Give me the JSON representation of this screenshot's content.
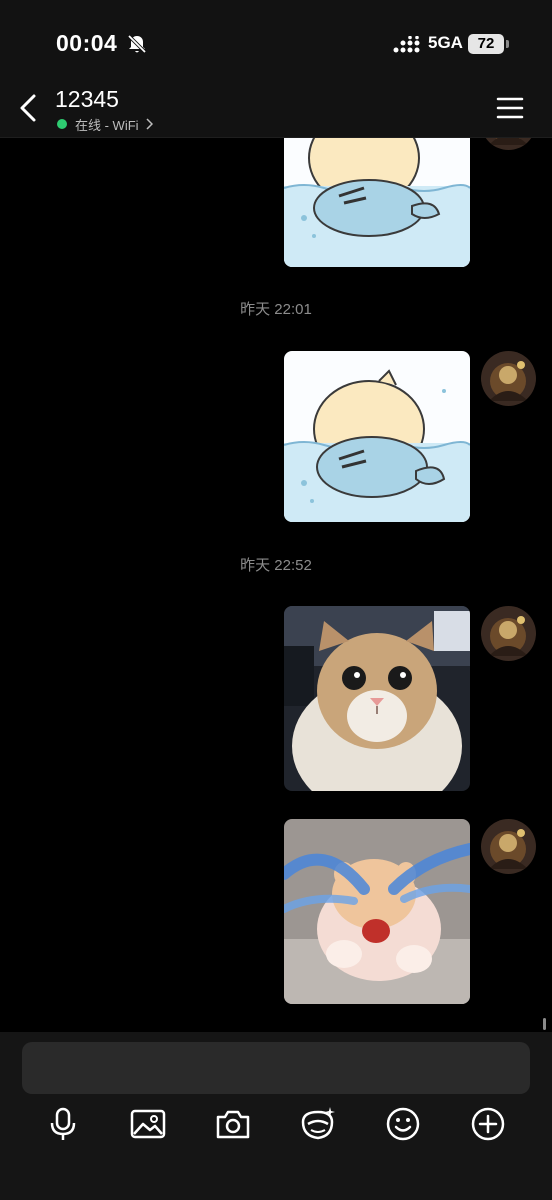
{
  "status_bar": {
    "time": "00:04",
    "network": "5GA",
    "battery": "72"
  },
  "header": {
    "contact_name": "12345",
    "presence": "在线 - WiFi"
  },
  "messages": [
    {
      "type": "image",
      "sender": "me",
      "description_icon": "sticker-swimming-cat"
    },
    {
      "type": "timestamp",
      "text": "昨天 22:01"
    },
    {
      "type": "image",
      "sender": "me",
      "description_icon": "sticker-swimming-cat"
    },
    {
      "type": "timestamp",
      "text": "昨天 22:52"
    },
    {
      "type": "image",
      "sender": "me",
      "description_icon": "photo-cat"
    },
    {
      "type": "image",
      "sender": "me",
      "description_icon": "sticker-crying-hamster"
    }
  ],
  "input": {
    "value": "",
    "placeholder": ""
  },
  "toolbar": {
    "icons": [
      "microphone-icon",
      "image-icon",
      "camera-icon",
      "sticker-icon",
      "emoji-icon",
      "plus-icon"
    ]
  },
  "colors": {
    "background": "#000000",
    "bar": "#151515",
    "online": "#2ecc71",
    "timestamp": "#8c8c8c"
  }
}
